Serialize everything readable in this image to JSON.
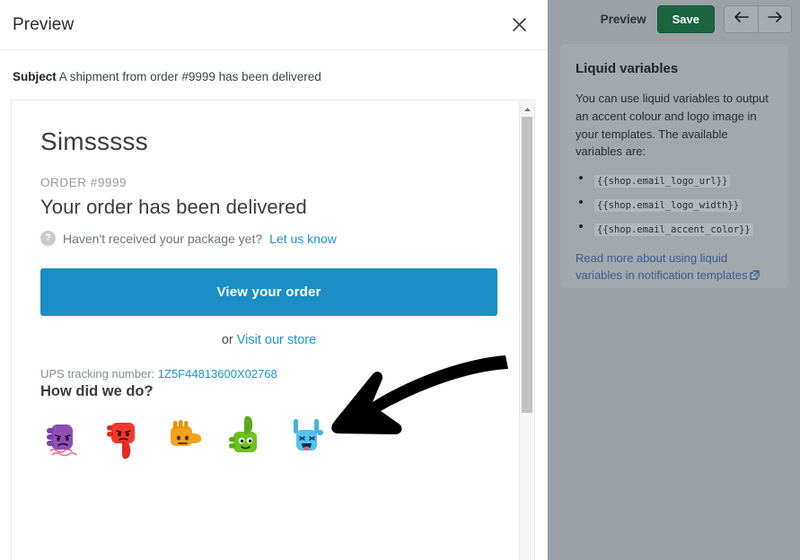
{
  "modal": {
    "title": "Preview",
    "close_icon": "close-icon"
  },
  "subject": {
    "label": "Subject",
    "value": "A shipment from order #9999 has been delivered"
  },
  "email": {
    "shop_name": "Simsssss",
    "order_label": "ORDER #9999",
    "headline": "Your order has been delivered",
    "help_icon": "?",
    "help_text": "Haven't received your package yet?",
    "help_link": "Let us know",
    "cta_label": "View your order",
    "or_text": "or ",
    "store_link": "Visit our store",
    "tracking_label": "UPS tracking number: ",
    "tracking_number": "1Z5F44813600X02768",
    "rate_heading": "How did we do?",
    "ratings": [
      {
        "name": "rating-emoji-angry-fist",
        "color": "#8e4fb5",
        "label": "angry fist"
      },
      {
        "name": "rating-emoji-thumbs-down",
        "color": "#f0392f",
        "label": "thumbs down"
      },
      {
        "name": "rating-emoji-neutral-hand",
        "color": "#f5a21b",
        "label": "neutral hand"
      },
      {
        "name": "rating-emoji-thumbs-up",
        "color": "#6cc020",
        "label": "thumbs up"
      },
      {
        "name": "rating-emoji-rock-on",
        "color": "#54c2f0",
        "label": "rock on"
      }
    ]
  },
  "scrollbar": {
    "up_arrow_icon": "chevron-up-icon"
  },
  "annotation": {
    "arrow_icon": "pointer-arrow-icon",
    "color": "#000000"
  },
  "sidebar": {
    "toolbar": {
      "preview_label": "Preview",
      "save_label": "Save",
      "prev_icon": "arrow-left-icon",
      "next_icon": "arrow-right-icon"
    },
    "card": {
      "title": "Liquid variables",
      "description": "You can use liquid variables to output an accent colour and logo image in your templates. The available variables are:",
      "variables": [
        "{{shop.email_logo_url}}",
        "{{shop.email_logo_width}}",
        "{{shop.email_accent_color}}"
      ],
      "link_text": "Read more about using liquid variables in notification templates",
      "link_icon": "external-link-icon"
    }
  },
  "colors": {
    "accent_blue": "#1b8fc6",
    "link_blue": "#1a94d2",
    "save_green": "#18653f",
    "sidebar_bg": "#9ba1a6"
  }
}
